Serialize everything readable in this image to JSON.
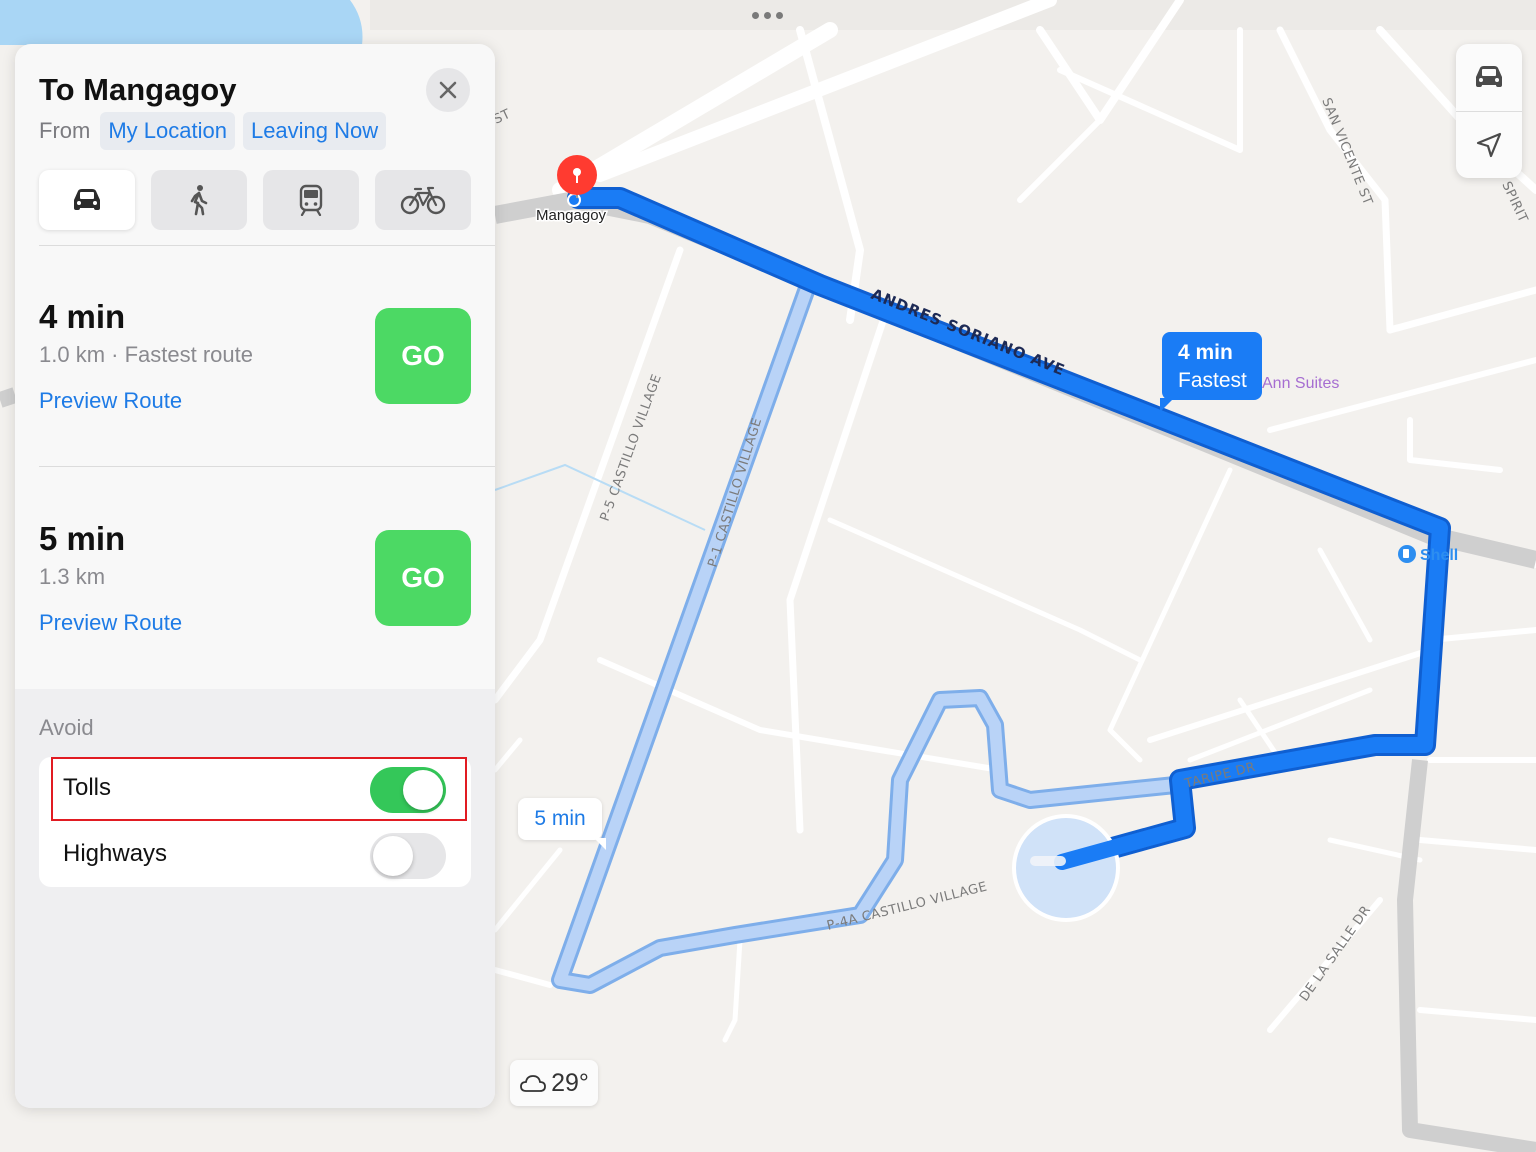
{
  "panel": {
    "title": "To Mangagoy",
    "from_label": "From",
    "from_value": "My Location",
    "departure": "Leaving Now",
    "modes": [
      {
        "name": "driving",
        "icon": "car-icon",
        "selected": true
      },
      {
        "name": "walking",
        "icon": "walking-icon",
        "selected": false
      },
      {
        "name": "transit",
        "icon": "train-icon",
        "selected": false
      },
      {
        "name": "cycling",
        "icon": "bicycle-icon",
        "selected": false
      }
    ],
    "routes": [
      {
        "time": "4 min",
        "detail": "1.0 km · Fastest route",
        "preview_label": "Preview Route",
        "go_label": "GO"
      },
      {
        "time": "5 min",
        "detail": "1.3 km",
        "preview_label": "Preview Route",
        "go_label": "GO"
      }
    ],
    "avoid": {
      "title": "Avoid",
      "options": [
        {
          "label": "Tolls",
          "on": true
        },
        {
          "label": "Highways",
          "on": false
        }
      ]
    }
  },
  "map": {
    "destination_label": "Mangagoy",
    "road_labels": {
      "andres": "ANDRES SORIANO AVE",
      "p1": "P-1 CASTILLO VILLAGE",
      "p5": "P-5 CASTILLO VILLAGE",
      "p4a": "P-4A CASTILLO VILLAGE",
      "taripe": "TARIPE DR",
      "sanvicente": "SAN VICENTE ST",
      "delasalle": "DE LA SALLE DR",
      "st": "ST",
      "spirit": "SPIRIT"
    },
    "poi": {
      "ann_suites": "Ann Suites",
      "shell": "Shell"
    },
    "callouts": {
      "fastest_time": "4 min",
      "fastest_label": "Fastest",
      "alt_time": "5 min"
    },
    "weather": "29°",
    "colors": {
      "route_primary": "#1a7cf5",
      "route_alt": "#a8c9f5",
      "go": "#4cd964",
      "toggle_on": "#34c759"
    }
  }
}
